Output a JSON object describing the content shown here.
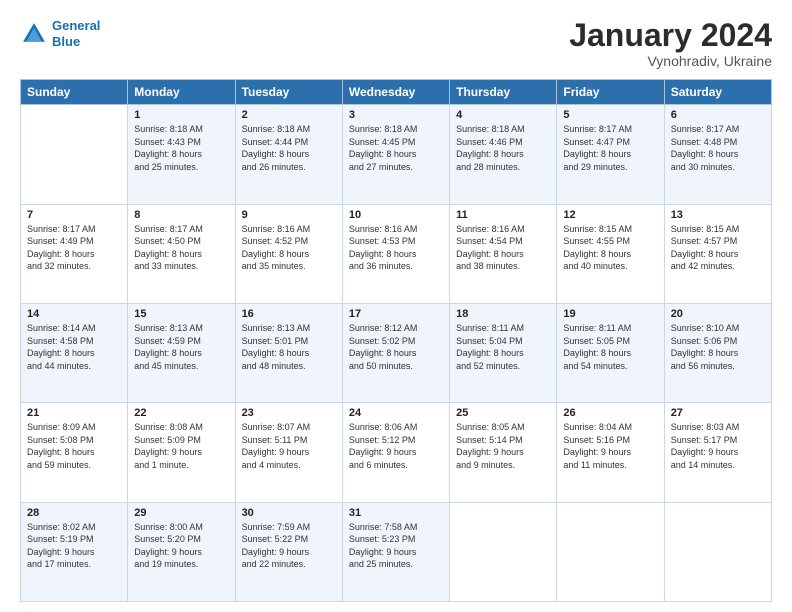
{
  "logo": {
    "line1": "General",
    "line2": "Blue"
  },
  "title": "January 2024",
  "location": "Vynohradiv, Ukraine",
  "headers": [
    "Sunday",
    "Monday",
    "Tuesday",
    "Wednesday",
    "Thursday",
    "Friday",
    "Saturday"
  ],
  "weeks": [
    [
      {
        "day": "",
        "info": ""
      },
      {
        "day": "1",
        "info": "Sunrise: 8:18 AM\nSunset: 4:43 PM\nDaylight: 8 hours\nand 25 minutes."
      },
      {
        "day": "2",
        "info": "Sunrise: 8:18 AM\nSunset: 4:44 PM\nDaylight: 8 hours\nand 26 minutes."
      },
      {
        "day": "3",
        "info": "Sunrise: 8:18 AM\nSunset: 4:45 PM\nDaylight: 8 hours\nand 27 minutes."
      },
      {
        "day": "4",
        "info": "Sunrise: 8:18 AM\nSunset: 4:46 PM\nDaylight: 8 hours\nand 28 minutes."
      },
      {
        "day": "5",
        "info": "Sunrise: 8:17 AM\nSunset: 4:47 PM\nDaylight: 8 hours\nand 29 minutes."
      },
      {
        "day": "6",
        "info": "Sunrise: 8:17 AM\nSunset: 4:48 PM\nDaylight: 8 hours\nand 30 minutes."
      }
    ],
    [
      {
        "day": "7",
        "info": "Sunrise: 8:17 AM\nSunset: 4:49 PM\nDaylight: 8 hours\nand 32 minutes."
      },
      {
        "day": "8",
        "info": "Sunrise: 8:17 AM\nSunset: 4:50 PM\nDaylight: 8 hours\nand 33 minutes."
      },
      {
        "day": "9",
        "info": "Sunrise: 8:16 AM\nSunset: 4:52 PM\nDaylight: 8 hours\nand 35 minutes."
      },
      {
        "day": "10",
        "info": "Sunrise: 8:16 AM\nSunset: 4:53 PM\nDaylight: 8 hours\nand 36 minutes."
      },
      {
        "day": "11",
        "info": "Sunrise: 8:16 AM\nSunset: 4:54 PM\nDaylight: 8 hours\nand 38 minutes."
      },
      {
        "day": "12",
        "info": "Sunrise: 8:15 AM\nSunset: 4:55 PM\nDaylight: 8 hours\nand 40 minutes."
      },
      {
        "day": "13",
        "info": "Sunrise: 8:15 AM\nSunset: 4:57 PM\nDaylight: 8 hours\nand 42 minutes."
      }
    ],
    [
      {
        "day": "14",
        "info": "Sunrise: 8:14 AM\nSunset: 4:58 PM\nDaylight: 8 hours\nand 44 minutes."
      },
      {
        "day": "15",
        "info": "Sunrise: 8:13 AM\nSunset: 4:59 PM\nDaylight: 8 hours\nand 45 minutes."
      },
      {
        "day": "16",
        "info": "Sunrise: 8:13 AM\nSunset: 5:01 PM\nDaylight: 8 hours\nand 48 minutes."
      },
      {
        "day": "17",
        "info": "Sunrise: 8:12 AM\nSunset: 5:02 PM\nDaylight: 8 hours\nand 50 minutes."
      },
      {
        "day": "18",
        "info": "Sunrise: 8:11 AM\nSunset: 5:04 PM\nDaylight: 8 hours\nand 52 minutes."
      },
      {
        "day": "19",
        "info": "Sunrise: 8:11 AM\nSunset: 5:05 PM\nDaylight: 8 hours\nand 54 minutes."
      },
      {
        "day": "20",
        "info": "Sunrise: 8:10 AM\nSunset: 5:06 PM\nDaylight: 8 hours\nand 56 minutes."
      }
    ],
    [
      {
        "day": "21",
        "info": "Sunrise: 8:09 AM\nSunset: 5:08 PM\nDaylight: 8 hours\nand 59 minutes."
      },
      {
        "day": "22",
        "info": "Sunrise: 8:08 AM\nSunset: 5:09 PM\nDaylight: 9 hours\nand 1 minute."
      },
      {
        "day": "23",
        "info": "Sunrise: 8:07 AM\nSunset: 5:11 PM\nDaylight: 9 hours\nand 4 minutes."
      },
      {
        "day": "24",
        "info": "Sunrise: 8:06 AM\nSunset: 5:12 PM\nDaylight: 9 hours\nand 6 minutes."
      },
      {
        "day": "25",
        "info": "Sunrise: 8:05 AM\nSunset: 5:14 PM\nDaylight: 9 hours\nand 9 minutes."
      },
      {
        "day": "26",
        "info": "Sunrise: 8:04 AM\nSunset: 5:16 PM\nDaylight: 9 hours\nand 11 minutes."
      },
      {
        "day": "27",
        "info": "Sunrise: 8:03 AM\nSunset: 5:17 PM\nDaylight: 9 hours\nand 14 minutes."
      }
    ],
    [
      {
        "day": "28",
        "info": "Sunrise: 8:02 AM\nSunset: 5:19 PM\nDaylight: 9 hours\nand 17 minutes."
      },
      {
        "day": "29",
        "info": "Sunrise: 8:00 AM\nSunset: 5:20 PM\nDaylight: 9 hours\nand 19 minutes."
      },
      {
        "day": "30",
        "info": "Sunrise: 7:59 AM\nSunset: 5:22 PM\nDaylight: 9 hours\nand 22 minutes."
      },
      {
        "day": "31",
        "info": "Sunrise: 7:58 AM\nSunset: 5:23 PM\nDaylight: 9 hours\nand 25 minutes."
      },
      {
        "day": "",
        "info": ""
      },
      {
        "day": "",
        "info": ""
      },
      {
        "day": "",
        "info": ""
      }
    ]
  ]
}
